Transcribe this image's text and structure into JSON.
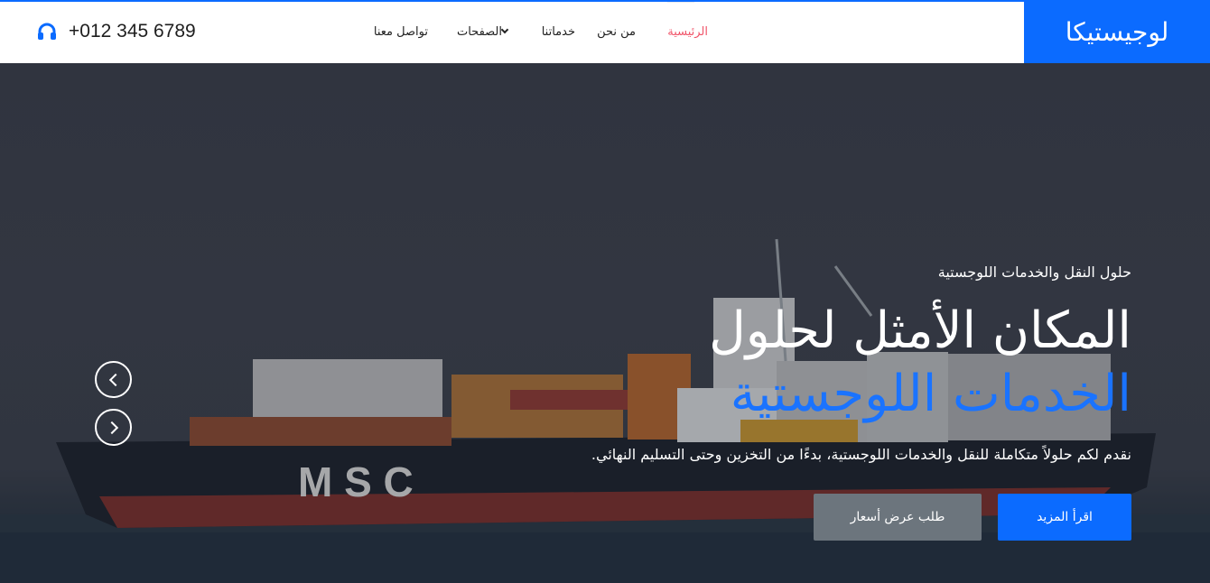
{
  "brand": {
    "name": "لوجيستيكا"
  },
  "nav": {
    "items": [
      {
        "label": "الرئيسية",
        "active": true
      },
      {
        "label": "من نحن",
        "active": false
      },
      {
        "label": "خدماتنا",
        "active": false
      },
      {
        "label": "الصفحات",
        "active": false,
        "dropdown": true
      },
      {
        "label": "تواصل معنا",
        "active": false
      }
    ]
  },
  "contact": {
    "phone": "+012 345 6789",
    "icon": "headset-icon"
  },
  "hero": {
    "subtitle": "حلول النقل والخدمات اللوجستية",
    "headline_part1": "المكان الأمثل لحلول",
    "headline_accent": "الخدمات اللوجستية",
    "description": "نقدم لكم حلولاً متكاملة للنقل والخدمات اللوجستية، بدءًا من التخزين وحتى التسليم النهائي.",
    "ship_text": "M S C",
    "buttons": {
      "primary": "اقرأ المزيد",
      "secondary": "طلب عرض أسعار"
    }
  },
  "colors": {
    "accent": "#0b6bff",
    "active_nav": "#f0556a",
    "secondary_button": "#6c757d"
  }
}
